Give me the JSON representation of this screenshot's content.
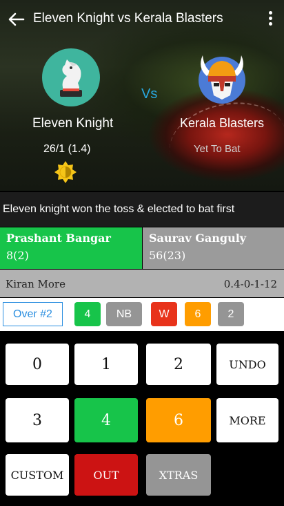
{
  "header": {
    "title": "Eleven Knight vs Kerala Blasters",
    "back_icon": "arrow-left-icon",
    "menu_icon": "more-vertical-icon"
  },
  "match": {
    "team1": {
      "name": "Eleven Knight",
      "score": "26/1 (1.4)",
      "logo": "chess-knight-logo"
    },
    "vs": "Vs",
    "team2": {
      "name": "Kerala Blasters",
      "status": "Yet To Bat",
      "logo": "viking-helmet-logo"
    },
    "batting_indicator_icon": "sun-icon"
  },
  "toss": "Eleven knight won the toss & elected to bat first",
  "batsmen": [
    {
      "name": "Prashant Bangar",
      "score": "8(2)",
      "on_strike": true
    },
    {
      "name": "Saurav Ganguly",
      "score": "56(23)",
      "on_strike": false
    }
  ],
  "bowler": {
    "name": "Kiran More",
    "figures": "0.4-0-1-12"
  },
  "over": {
    "label": "Over #2",
    "balls": [
      {
        "text": "4",
        "color": "#17c44a"
      },
      {
        "text": "NB",
        "color": "#959595"
      },
      {
        "text": "W",
        "color": "#e8331b"
      },
      {
        "text": "6",
        "color": "#ff9d00"
      },
      {
        "text": "2",
        "color": "#959595"
      }
    ]
  },
  "keypad": {
    "k0": "0",
    "k1": "1",
    "k2": "2",
    "undo": "UNDO",
    "k3": "3",
    "k4": "4",
    "k6": "6",
    "more": "MORE",
    "custom": "CUSTOM",
    "out": "OUT",
    "xtras": "XTRAS"
  },
  "colors": {
    "green": "#17c44a",
    "orange": "#ff9d00",
    "red": "#cc1313",
    "gray": "#959595",
    "accent_blue": "#29a9e1"
  }
}
